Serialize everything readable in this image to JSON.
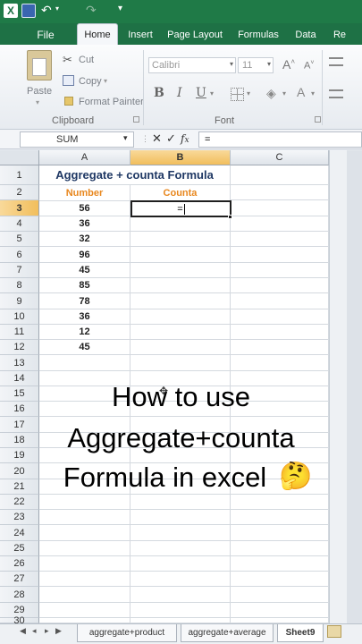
{
  "qat": {
    "excel_icon": "excel-logo-icon",
    "save_icon": "save-icon",
    "undo_icon": "undo-icon",
    "redo_icon": "redo-icon"
  },
  "tabs": {
    "file": "File",
    "home": "Home",
    "insert": "Insert",
    "page_layout": "Page Layout",
    "formulas": "Formulas",
    "data": "Data",
    "review": "Re"
  },
  "ribbon": {
    "paste": "Paste",
    "cut": "Cut",
    "copy": "Copy",
    "format_painter": "Format Painter",
    "clipboard_group": "Clipboard",
    "font_name": "Calibri",
    "font_size": "11",
    "font_group": "Font",
    "bold": "B",
    "italic": "I",
    "underline": "U"
  },
  "formula_bar": {
    "name_box": "SUM",
    "formula": "="
  },
  "columns": [
    "A",
    "B",
    "C"
  ],
  "rows": [
    "1",
    "2",
    "3",
    "4",
    "5",
    "6",
    "7",
    "8",
    "9",
    "10",
    "11",
    "12",
    "13",
    "14",
    "15",
    "16",
    "17",
    "18",
    "19",
    "20",
    "21",
    "22",
    "23",
    "24",
    "25",
    "26",
    "27",
    "28",
    "29",
    "30"
  ],
  "sheet": {
    "title": "Aggregate + counta Formula",
    "header_a": "Number",
    "header_b": "Counta",
    "active_cell_text": "=",
    "numbers": [
      "56",
      "36",
      "32",
      "96",
      "45",
      "85",
      "78",
      "36",
      "12",
      "45"
    ]
  },
  "sheet_tabs": [
    "aggregate+product",
    "aggregate+average",
    "Sheet9"
  ],
  "overlay": {
    "line1": "How to use",
    "line2": "Aggregate+counta",
    "line3": "Formula in excel",
    "emoji": "🤔"
  },
  "colors": {
    "header_orange": "#e8871e",
    "title_blue": "#1f3864",
    "excel_green": "#1e7145",
    "selection_green": "#217346"
  }
}
